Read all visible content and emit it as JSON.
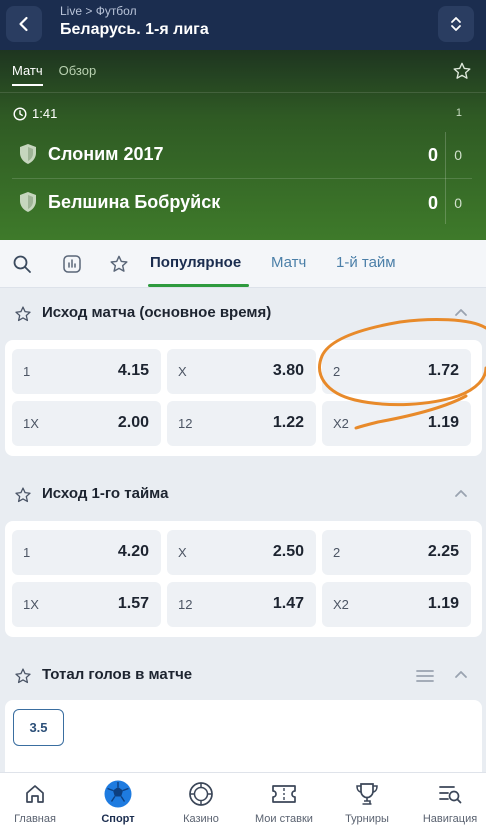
{
  "header": {
    "breadcrumb": "Live > Футбол",
    "title": "Беларусь. 1-я лига"
  },
  "banner": {
    "tabs": [
      {
        "label": "Матч",
        "active": true
      },
      {
        "label": "Обзор",
        "active": false
      }
    ],
    "timer": "1:41",
    "period": "1",
    "teams": [
      {
        "name": "Слоним 2017",
        "score": "0",
        "sub_score": "0"
      },
      {
        "name": "Белшина Бобруйск",
        "score": "0",
        "sub_score": "0"
      }
    ]
  },
  "filter": {
    "tabs": [
      {
        "label": "Популярное",
        "active": true
      },
      {
        "label": "Матч",
        "active": false
      },
      {
        "label": "1-й тайм",
        "active": false
      }
    ]
  },
  "markets": [
    {
      "title": "Исход матча (основное время)",
      "odds": [
        [
          {
            "label": "1",
            "value": "4.15"
          },
          {
            "label": "X",
            "value": "3.80"
          },
          {
            "label": "2",
            "value": "1.72"
          }
        ],
        [
          {
            "label": "1X",
            "value": "2.00"
          },
          {
            "label": "12",
            "value": "1.22"
          },
          {
            "label": "X2",
            "value": "1.19"
          }
        ]
      ]
    },
    {
      "title": "Исход 1-го тайма",
      "odds": [
        [
          {
            "label": "1",
            "value": "4.20"
          },
          {
            "label": "X",
            "value": "2.50"
          },
          {
            "label": "2",
            "value": "2.25"
          }
        ],
        [
          {
            "label": "1X",
            "value": "1.57"
          },
          {
            "label": "12",
            "value": "1.47"
          },
          {
            "label": "X2",
            "value": "1.19"
          }
        ]
      ]
    },
    {
      "title": "Тотал голов в матче",
      "chip": "3.5"
    }
  ],
  "nav": [
    {
      "label": "Главная",
      "icon": "home-icon"
    },
    {
      "label": "Спорт",
      "icon": "soccer-ball-icon",
      "active": true
    },
    {
      "label": "Казино",
      "icon": "casino-chip-icon"
    },
    {
      "label": "Мои ставки",
      "icon": "ticket-icon"
    },
    {
      "label": "Турниры",
      "icon": "trophy-icon"
    },
    {
      "label": "Навигация",
      "icon": "navigation-search-icon"
    }
  ],
  "colors": {
    "header_bg": "#1b2d4f",
    "accent_green": "#2e9a3e",
    "link_blue": "#4b7fa8",
    "annotation": "#e88a2a"
  }
}
